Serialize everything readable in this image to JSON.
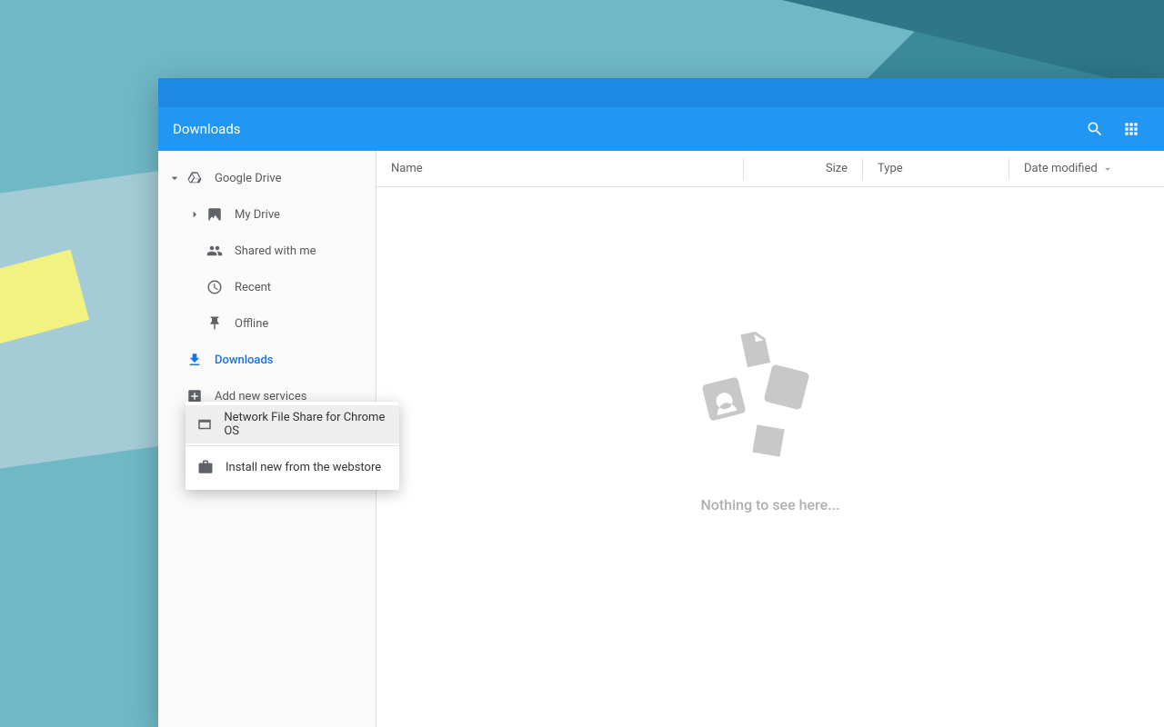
{
  "header": {
    "title": "Downloads"
  },
  "sidebar": {
    "google_drive": "Google Drive",
    "my_drive": "My Drive",
    "shared_with_me": "Shared with me",
    "recent": "Recent",
    "offline": "Offline",
    "downloads": "Downloads",
    "add_new_services": "Add new services"
  },
  "popup": {
    "network_share": "Network File Share for Chrome OS",
    "install_webstore": "Install new from the webstore"
  },
  "columns": {
    "name": "Name",
    "size": "Size",
    "type": "Type",
    "date_modified": "Date modified"
  },
  "empty_state": {
    "message": "Nothing to see here..."
  }
}
